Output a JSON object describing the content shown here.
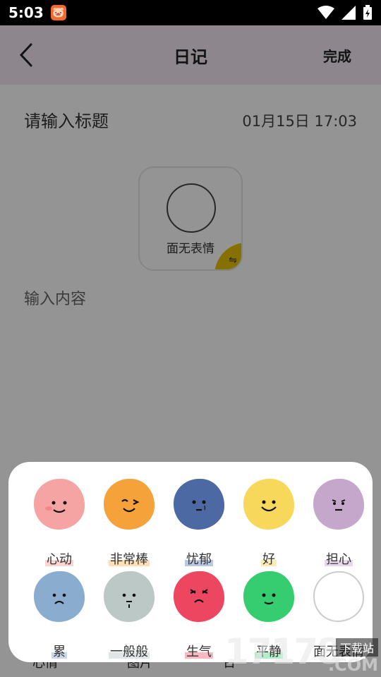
{
  "status_bar": {
    "time": "5:03"
  },
  "app_bar": {
    "title": "日记",
    "done_label": "完成"
  },
  "editor": {
    "title_placeholder": "请输入标题",
    "date": "01月15日 17:03",
    "current_mood_label": "面无表情",
    "content_placeholder": "输入内容"
  },
  "bottom_nav": {
    "item1": "心情",
    "item2": "图片",
    "item3": "日"
  },
  "moods": [
    {
      "label": "心动",
      "color": "#f6a3a3",
      "highlight": "#fbd4d4",
      "expression": "shy"
    },
    {
      "label": "非常棒",
      "color": "#f6a23a",
      "highlight": "#fde0b8",
      "expression": "wink"
    },
    {
      "label": "忧郁",
      "color": "#4d69a3",
      "highlight": "#b9c7e0",
      "expression": "sad"
    },
    {
      "label": "好",
      "color": "#f7d85a",
      "highlight": "#fbecb4",
      "expression": "smile"
    },
    {
      "label": "担心",
      "color": "#c5a7cc",
      "highlight": "#e6d8ea",
      "expression": "worry"
    },
    {
      "label": "累",
      "color": "#8aadcf",
      "highlight": "#c9d9ea",
      "expression": "tired"
    },
    {
      "label": "一般般",
      "color": "#bcc8c6",
      "highlight": "#dfe6e5",
      "expression": "meh"
    },
    {
      "label": "生气",
      "color": "#ec4661",
      "highlight": "#f8b9c4",
      "expression": "angry"
    },
    {
      "label": "平静",
      "color": "#36cc70",
      "highlight": "#b5ecc9",
      "expression": "calm"
    },
    {
      "label": "面无表情",
      "color": "#ffffff",
      "highlight": "#ffffff",
      "expression": "blank"
    }
  ],
  "watermark": {
    "text": "17178",
    "sub": "下载站",
    "domain": ".COM"
  }
}
